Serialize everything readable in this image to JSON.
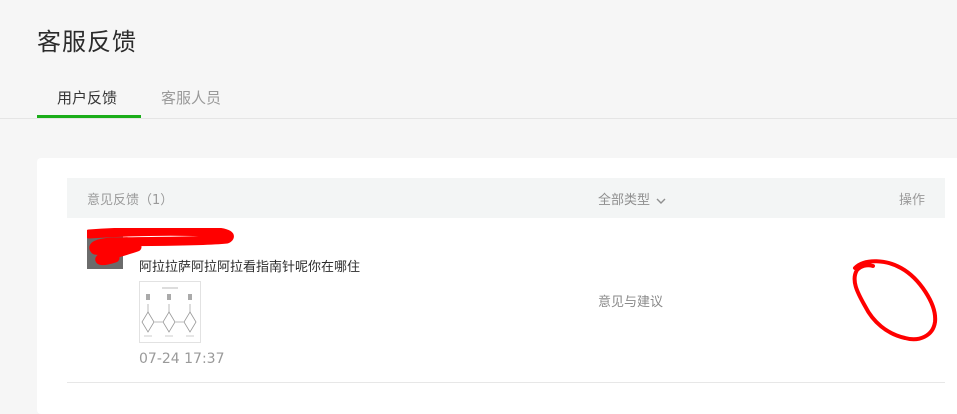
{
  "page": {
    "title": "客服反馈"
  },
  "tabs": [
    {
      "label": "用户反馈",
      "active": true
    },
    {
      "label": "客服人员",
      "active": false
    }
  ],
  "table": {
    "header": {
      "feedback": "意见反馈（1）",
      "type_filter": "全部类型",
      "operation": "操作"
    },
    "rows": [
      {
        "text": "阿拉拉萨阿拉阿拉看指南针呢你在哪住",
        "type": "意见与建议",
        "time": "07-24 17:37"
      }
    ]
  },
  "colors": {
    "accent": "#1aad19",
    "annotation": "#ff0000"
  }
}
